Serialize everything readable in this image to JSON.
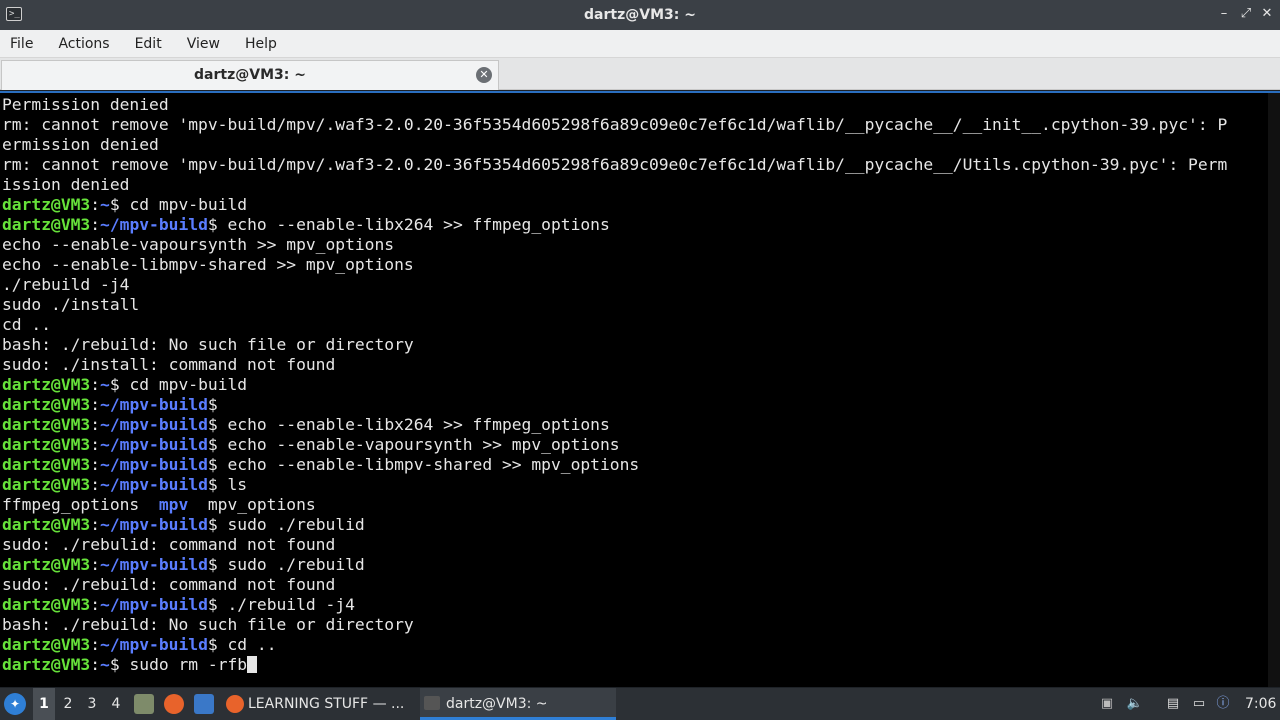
{
  "window": {
    "title": "dartz@VM3: ~",
    "controls": [
      "minimize-icon",
      "restore-icon",
      "close-icon"
    ],
    "app_icon_text": ">_"
  },
  "menu": [
    "File",
    "Actions",
    "Edit",
    "View",
    "Help"
  ],
  "tab": {
    "label": "dartz@VM3: ~",
    "close_symbol": "✕"
  },
  "colors": {
    "prompt_user": "#66e23a",
    "prompt_path": "#5a7dff",
    "terminal_bg": "#000000",
    "text": "#e6e6e6"
  },
  "terminal": {
    "lines": [
      {
        "type": "out",
        "text": "Permission denied"
      },
      {
        "type": "out",
        "text": "rm: cannot remove 'mpv-build/mpv/.waf3-2.0.20-36f5354d605298f6a89c09e0c7ef6c1d/waflib/__pycache__/__init__.cpython-39.pyc': P"
      },
      {
        "type": "out",
        "text": "ermission denied"
      },
      {
        "type": "out",
        "text": "rm: cannot remove 'mpv-build/mpv/.waf3-2.0.20-36f5354d605298f6a89c09e0c7ef6c1d/waflib/__pycache__/Utils.cpython-39.pyc': Perm"
      },
      {
        "type": "out",
        "text": "ission denied"
      },
      {
        "type": "prompt",
        "user": "dartz@VM3",
        "path": "~",
        "cmd": " cd mpv-build"
      },
      {
        "type": "prompt",
        "user": "dartz@VM3",
        "path": "~/mpv-build",
        "cmd": " echo --enable-libx264 >> ffmpeg_options"
      },
      {
        "type": "out",
        "text": "echo --enable-vapoursynth >> mpv_options"
      },
      {
        "type": "out",
        "text": "echo --enable-libmpv-shared >> mpv_options"
      },
      {
        "type": "out",
        "text": "./rebuild -j4"
      },
      {
        "type": "out",
        "text": "sudo ./install"
      },
      {
        "type": "out",
        "text": "cd .."
      },
      {
        "type": "out",
        "text": "bash: ./rebuild: No such file or directory"
      },
      {
        "type": "out",
        "text": "sudo: ./install: command not found"
      },
      {
        "type": "prompt",
        "user": "dartz@VM3",
        "path": "~",
        "cmd": " cd mpv-build"
      },
      {
        "type": "prompt",
        "user": "dartz@VM3",
        "path": "~/mpv-build",
        "cmd": ""
      },
      {
        "type": "prompt",
        "user": "dartz@VM3",
        "path": "~/mpv-build",
        "cmd": " echo --enable-libx264 >> ffmpeg_options"
      },
      {
        "type": "prompt",
        "user": "dartz@VM3",
        "path": "~/mpv-build",
        "cmd": " echo --enable-vapoursynth >> mpv_options"
      },
      {
        "type": "prompt",
        "user": "dartz@VM3",
        "path": "~/mpv-build",
        "cmd": " echo --enable-libmpv-shared >> mpv_options"
      },
      {
        "type": "prompt",
        "user": "dartz@VM3",
        "path": "~/mpv-build",
        "cmd": " ls"
      },
      {
        "type": "ls",
        "parts": [
          {
            "t": "ffmpeg_options  ",
            "dir": false
          },
          {
            "t": "mpv",
            "dir": true
          },
          {
            "t": "  mpv_options",
            "dir": false
          }
        ]
      },
      {
        "type": "prompt",
        "user": "dartz@VM3",
        "path": "~/mpv-build",
        "cmd": " sudo ./rebulid"
      },
      {
        "type": "out",
        "text": "sudo: ./rebulid: command not found"
      },
      {
        "type": "prompt",
        "user": "dartz@VM3",
        "path": "~/mpv-build",
        "cmd": " sudo ./rebuild"
      },
      {
        "type": "out",
        "text": "sudo: ./rebuild: command not found"
      },
      {
        "type": "prompt",
        "user": "dartz@VM3",
        "path": "~/mpv-build",
        "cmd": " ./rebuild -j4"
      },
      {
        "type": "out",
        "text": "bash: ./rebuild: No such file or directory"
      },
      {
        "type": "prompt",
        "user": "dartz@VM3",
        "path": "~/mpv-build",
        "cmd": " cd .."
      },
      {
        "type": "prompt",
        "user": "dartz@VM3",
        "path": "~",
        "cmd": " sudo rm -rfb",
        "cursor": true
      }
    ]
  },
  "taskbar": {
    "workspaces": [
      "1",
      "2",
      "3",
      "4"
    ],
    "active_workspace": "1",
    "tasks": [
      {
        "label": "LEARNING STUFF — ...",
        "icon": "firefox-icon"
      },
      {
        "label": "dartz@VM3: ~",
        "icon": "terminal-icon",
        "active": true
      }
    ],
    "clock": "7:06"
  }
}
